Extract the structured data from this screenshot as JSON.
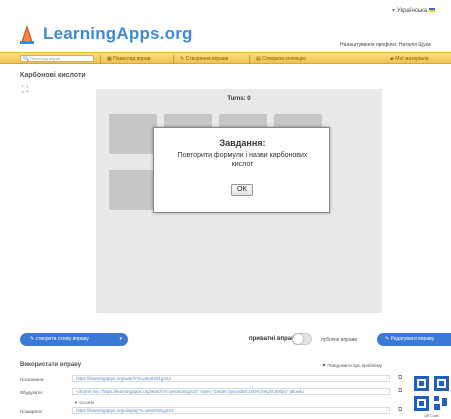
{
  "header": {
    "logo_text": "LearningApps.org",
    "language": "Українська",
    "profile_text": "Налаштування профілю: Наталія Щука"
  },
  "navbar": {
    "search_placeholder": "Перегляд вправ",
    "items": [
      {
        "label": "Перегляд вправ",
        "icon": "grid-icon"
      },
      {
        "label": "Створення вправи",
        "icon": "pencil-icon"
      },
      {
        "label": "Створити колекцію",
        "icon": "collection-icon"
      },
      {
        "label": "Мої матеріали",
        "icon": "folder-icon"
      }
    ]
  },
  "page": {
    "title": "Карбонові кислоти"
  },
  "game": {
    "turns_label": "Turns: 0",
    "card_count": 8,
    "dialog": {
      "title": "Завдання:",
      "text": "Повторити формули і назви карбонових кислот",
      "ok_label": "OK"
    }
  },
  "controls": {
    "create_label": "створити схожу вправу",
    "private_label": "приватні вправи",
    "public_label": "публічні вправи",
    "toggle_on": false,
    "edit_label": "Редагувати вправу"
  },
  "use": {
    "title": "Використати вправу",
    "report_label": "Повідомити про проблему",
    "rows": [
      {
        "label": "Посилання:",
        "value": "https://learningapps.org/watch?v=p6o6291gn24"
      },
      {
        "label": "Вбудувати:",
        "value": "<iframe src=\"https://learningapps.org/watch?v=p6o6291gn24\" style=\"border:0px;width:100%;height:500px\" allowfu"
      },
      {
        "label": "Поширити:",
        "value": "https://learningapps.org/display?v=p6o6291gn24"
      }
    ],
    "scorm_label": "SCORM",
    "qr_label": "QR Code"
  },
  "colors": {
    "accent": "#3b79d6",
    "navbar_top": "#fbdf86",
    "navbar_bottom": "#f0c14e",
    "logo": "#3d8ad6"
  }
}
